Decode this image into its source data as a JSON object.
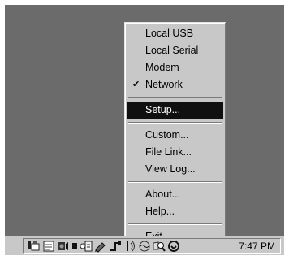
{
  "menu": {
    "items": [
      {
        "label": "Local USB",
        "checked": false
      },
      {
        "label": "Local Serial",
        "checked": false
      },
      {
        "label": "Modem",
        "checked": false
      },
      {
        "label": "Network",
        "checked": true
      },
      {
        "label": "Setup...",
        "selected": true
      },
      {
        "label": "Custom..."
      },
      {
        "label": "File Link..."
      },
      {
        "label": "View Log..."
      },
      {
        "label": "About..."
      },
      {
        "label": "Help..."
      },
      {
        "label": "Exit"
      }
    ],
    "check_glyph": "✔"
  },
  "tray": {
    "clock": "7:47 PM",
    "icons": [
      "sync-icon",
      "document-icon",
      "speaker-icon",
      "dot-icon",
      "calendar-icon",
      "pen-icon",
      "network-cable-icon",
      "antenna-icon",
      "wave-icon",
      "magnifier-icon",
      "power-plug-icon"
    ]
  }
}
